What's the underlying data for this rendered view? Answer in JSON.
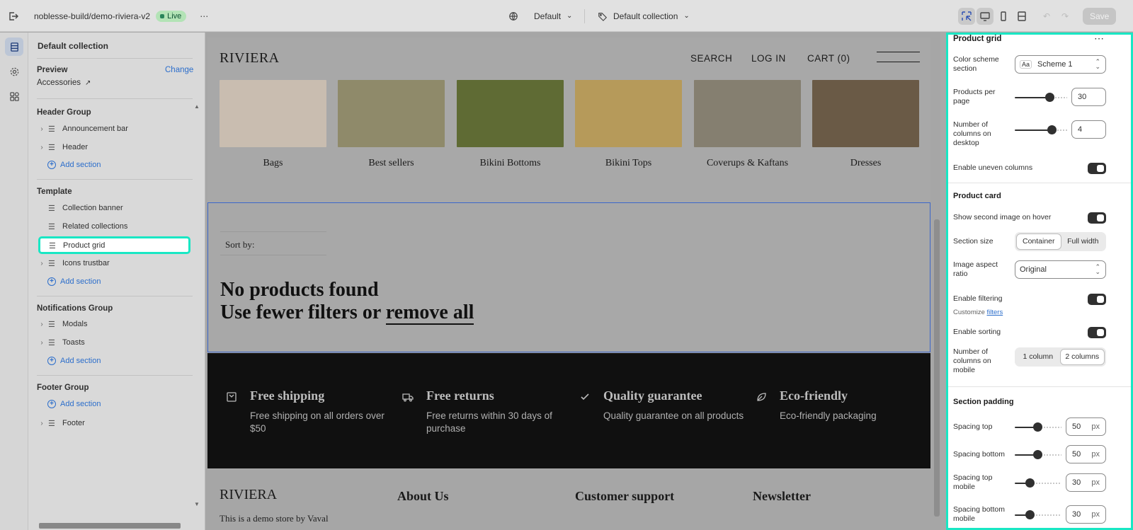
{
  "topbar": {
    "store": "noblesse-build/demo-riviera-v2",
    "status": "Live",
    "theme_select": "Default",
    "template_select": "Default collection",
    "save_label": "Save"
  },
  "left": {
    "title": "Default collection",
    "preview_label": "Preview",
    "preview_change": "Change",
    "preview_value": "Accessories",
    "groups": {
      "header_group": "Header Group",
      "template": "Template",
      "notifications_group": "Notifications Group",
      "footer_group": "Footer Group"
    },
    "header_items": [
      "Announcement bar",
      "Header"
    ],
    "template_items": [
      "Collection banner",
      "Related collections",
      "Product grid",
      "Icons trustbar"
    ],
    "notification_items": [
      "Modals",
      "Toasts"
    ],
    "footer_items": [
      "Footer"
    ],
    "add_section": "Add section"
  },
  "store": {
    "logo": "RIVIERA",
    "nav": [
      "SEARCH",
      "LOG IN",
      "CART (0)"
    ],
    "collections": [
      {
        "label": "Bags",
        "color": "#c9bdb0"
      },
      {
        "label": "Best sellers",
        "color": "#8f8a6a"
      },
      {
        "label": "Bikini Bottoms",
        "color": "#5f6b34"
      },
      {
        "label": "Bikini Tops",
        "color": "#b69a5a"
      },
      {
        "label": "Coverups & Kaftans",
        "color": "#857f70"
      },
      {
        "label": "Dresses",
        "color": "#6a5a46"
      }
    ],
    "sort_by": "Sort by:",
    "no_products_line1": "No products found",
    "no_products_line2_prefix": "Use fewer filters or ",
    "no_products_link": "remove all",
    "trust": [
      {
        "title": "Free shipping",
        "desc": "Free shipping on all orders over $50",
        "icon": "box-icon"
      },
      {
        "title": "Free returns",
        "desc": "Free returns within 30 days of purchase",
        "icon": "truck-icon"
      },
      {
        "title": "Quality guarantee",
        "desc": "Quality guarantee on all products",
        "icon": "check-icon"
      },
      {
        "title": "Eco-friendly",
        "desc": "Eco-friendly packaging",
        "icon": "leaf-icon"
      }
    ],
    "footer": {
      "logo": "RIVIERA",
      "about": "About Us",
      "support": "Customer support",
      "newsletter": "Newsletter",
      "desc": "This is a demo store by Vaval"
    }
  },
  "settings": {
    "title": "Product grid",
    "color_scheme_label": "Color scheme section",
    "color_scheme_value": "Scheme 1",
    "products_per_page_label": "Products per page",
    "products_per_page": "30",
    "products_per_page_level": 0.66,
    "columns_desktop_label": "Number of columns on desktop",
    "columns_desktop": "4",
    "columns_desktop_level": 0.7,
    "uneven_columns_label": "Enable uneven columns",
    "product_card_heading": "Product card",
    "second_image_label": "Show second image on hover",
    "section_size_label": "Section size",
    "section_size_options": [
      "Container",
      "Full width"
    ],
    "image_ratio_label": "Image aspect ratio",
    "image_ratio_value": "Original",
    "filtering_label": "Enable filtering",
    "customize_prefix": "Customize",
    "customize_link": "filters",
    "sorting_label": "Enable sorting",
    "columns_mobile_label": "Number of columns on mobile",
    "columns_mobile_options": [
      "1 column",
      "2 columns"
    ],
    "padding_heading": "Section padding",
    "spacing_top_label": "Spacing top",
    "spacing_top": "50",
    "spacing_bottom_label": "Spacing bottom",
    "spacing_bottom": "50",
    "spacing_top_mobile_label": "Spacing top mobile",
    "spacing_top_mobile": "30",
    "spacing_bottom_mobile_label": "Spacing bottom mobile",
    "spacing_bottom_mobile": "30",
    "unit": "px"
  }
}
